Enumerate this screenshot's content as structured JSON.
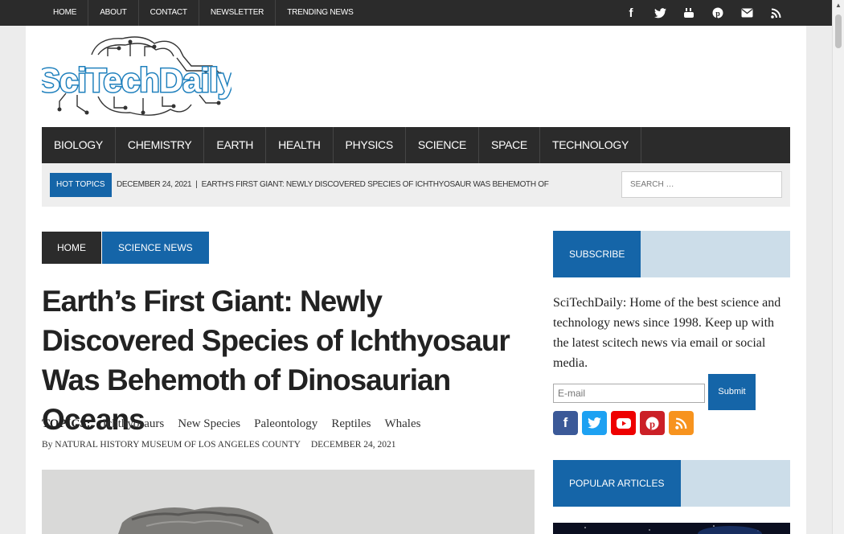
{
  "topnav": [
    "HOME",
    "ABOUT",
    "CONTACT",
    "NEWSLETTER",
    "TRENDING NEWS"
  ],
  "social_icons": [
    "facebook-icon",
    "twitter-icon",
    "youtube-icon",
    "pinterest-icon",
    "email-icon",
    "rss-icon"
  ],
  "site": {
    "logo_text": "SciTechDaily"
  },
  "mainnav": [
    "BIOLOGY",
    "CHEMISTRY",
    "EARTH",
    "HEALTH",
    "PHYSICS",
    "SCIENCE",
    "SPACE",
    "TECHNOLOGY"
  ],
  "hot": {
    "label": "HOT TOPICS",
    "date": "DECEMBER 24, 2021",
    "separator": "|",
    "headline": "EARTH'S FIRST GIANT: NEWLY DISCOVERED SPECIES OF ICHTHYOSAUR WAS BEHEMOTH OF"
  },
  "search": {
    "placeholder": "SEARCH …"
  },
  "breadcrumb": {
    "home": "HOME",
    "category": "SCIENCE NEWS"
  },
  "article": {
    "title": "Earth’s First Giant: Newly Discovered Species of Ichthyosaur Was Behemoth of Dinosaurian Oceans",
    "topics_label": "TOPICS:",
    "topics": [
      "Ichthyosaurs",
      "New Species",
      "Paleontology",
      "Reptiles",
      "Whales"
    ],
    "by": "By",
    "author": "NATURAL HISTORY MUSEUM OF LOS ANGELES COUNTY",
    "date": "DECEMBER 24, 2021"
  },
  "sidebar": {
    "subscribe_title": "SUBSCRIBE",
    "subscribe_text": "SciTechDaily: Home of the best science and technology news since 1998. Keep up with the latest scitech news via email or social media.",
    "email_placeholder": "E-mail",
    "submit_label": "Submit",
    "popular_title": "POPULAR ARTICLES"
  },
  "colors": {
    "brand_blue": "#1565a8",
    "dark": "#2b2b2b",
    "light_blue": "#ccdde9"
  }
}
